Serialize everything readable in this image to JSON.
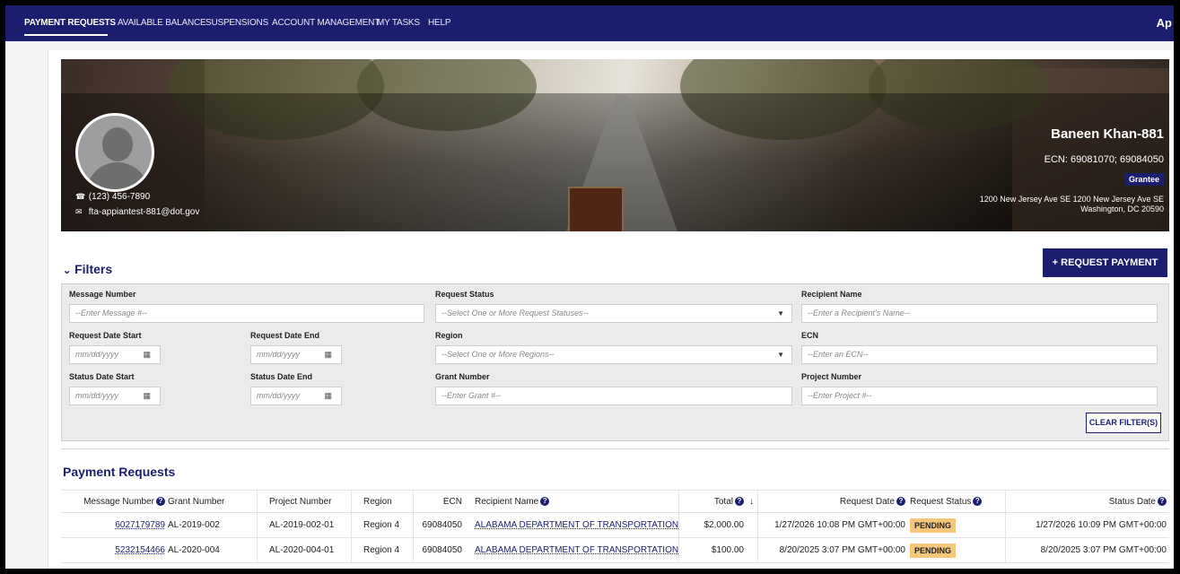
{
  "nav": {
    "items": [
      "PAYMENT REQUESTS",
      "AVAILABLE BALANCE",
      "SUSPENSIONS",
      "ACCOUNT MANAGEMENT",
      "MY TASKS",
      "HELP"
    ],
    "right_text": "Ap"
  },
  "profile": {
    "phone": "(123) 456-7890",
    "email": "fta-appiantest-881@dot.gov",
    "name": "Baneen Khan-881",
    "ecn": "ECN: 69081070; 69084050",
    "role": "Grantee",
    "address_line1": "1200 New Jersey Ave SE 1200 New Jersey Ave SE",
    "address_line2": "Washington, DC 20590"
  },
  "filters": {
    "title": "Filters",
    "request_payment_label": "+ REQUEST PAYMENT",
    "clear_label": "CLEAR FILTER(S)",
    "message_number": {
      "label": "Message Number",
      "placeholder": "--Enter Message #--"
    },
    "request_status": {
      "label": "Request Status",
      "placeholder": "--Select One or More Request Statuses--"
    },
    "recipient_name": {
      "label": "Recipient Name",
      "placeholder": "--Enter a Recipient's Name--"
    },
    "request_date_start": {
      "label": "Request Date Start",
      "placeholder": "mm/dd/yyyy"
    },
    "request_date_end": {
      "label": "Request Date End",
      "placeholder": "mm/dd/yyyy"
    },
    "region": {
      "label": "Region",
      "placeholder": "--Select One or More Regions--"
    },
    "ecn": {
      "label": "ECN",
      "placeholder": "--Enter an ECN--"
    },
    "status_date_start": {
      "label": "Status Date Start",
      "placeholder": "mm/dd/yyyy"
    },
    "status_date_end": {
      "label": "Status Date End",
      "placeholder": "mm/dd/yyyy"
    },
    "grant_number": {
      "label": "Grant Number",
      "placeholder": "--Enter Grant #--"
    },
    "project_number": {
      "label": "Project Number",
      "placeholder": "--Enter Project #--"
    }
  },
  "payment_requests": {
    "title": "Payment Requests",
    "columns": [
      "Message Number",
      "Grant Number",
      "Project Number",
      "Region",
      "ECN",
      "Recipient Name",
      "Total",
      "Request Date",
      "Request Status",
      "Status Date"
    ],
    "sort_indicator": "↓",
    "rows": [
      {
        "message_number": "6027179789",
        "grant_number": "AL-2019-002",
        "project_number": "AL-2019-002-01",
        "region": "Region 4",
        "ecn": "69084050",
        "recipient": "ALABAMA DEPARTMENT OF TRANSPORTATION",
        "total": "$2,000.00",
        "request_date": "1/27/2026 10:08 PM GMT+00:00",
        "status": "PENDING",
        "status_date": "1/27/2026 10:09 PM GMT+00:00"
      },
      {
        "message_number": "5232154466",
        "grant_number": "AL-2020-004",
        "project_number": "AL-2020-004-01",
        "region": "Region 4",
        "ecn": "69084050",
        "recipient": "ALABAMA DEPARTMENT OF TRANSPORTATION",
        "total": "$100.00",
        "request_date": "8/20/2025 3:07 PM GMT+00:00",
        "status": "PENDING",
        "status_date": "8/20/2025 3:07 PM GMT+00:00"
      }
    ]
  },
  "colors": {
    "brand": "#1b1e6e",
    "pending": "#f6c67a"
  }
}
